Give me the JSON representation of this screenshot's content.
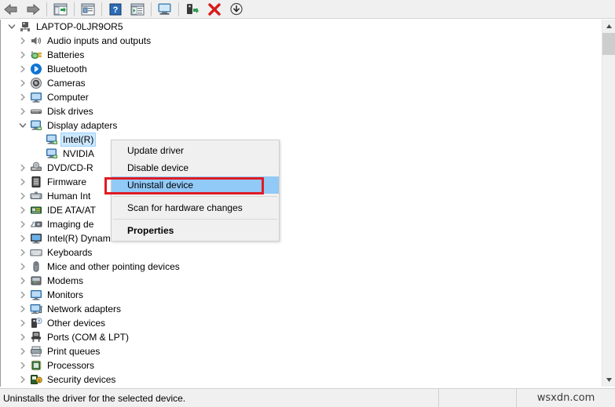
{
  "toolbar": {
    "buttons": [
      {
        "name": "back-icon",
        "label": "Back"
      },
      {
        "name": "forward-icon",
        "label": "Forward"
      },
      {
        "name": "sep",
        "label": ""
      },
      {
        "name": "show-hide-console-tree-icon",
        "label": "Show/Hide Console Tree"
      },
      {
        "name": "sep",
        "label": ""
      },
      {
        "name": "properties-icon",
        "label": "Properties"
      },
      {
        "name": "sep",
        "label": ""
      },
      {
        "name": "help-icon",
        "label": "Help"
      },
      {
        "name": "view-icon",
        "label": "View"
      },
      {
        "name": "sep",
        "label": ""
      },
      {
        "name": "scan-for-hardware-changes-icon",
        "label": "Scan for hardware changes"
      },
      {
        "name": "sep",
        "label": ""
      },
      {
        "name": "update-driver-icon",
        "label": "Update driver"
      },
      {
        "name": "uninstall-device-icon",
        "label": "Uninstall device"
      },
      {
        "name": "disable-device-icon",
        "label": "Disable device"
      }
    ]
  },
  "tree": {
    "rows": [
      {
        "label": "LAPTOP-0LJR9OR5",
        "depth": 0,
        "twisty": "expanded",
        "icon": "computer-node-icon",
        "selected": false
      },
      {
        "label": "Audio inputs and outputs",
        "depth": 1,
        "twisty": "collapsed",
        "icon": "speaker-icon",
        "selected": false
      },
      {
        "label": "Batteries",
        "depth": 1,
        "twisty": "collapsed",
        "icon": "battery-icon",
        "selected": false
      },
      {
        "label": "Bluetooth",
        "depth": 1,
        "twisty": "collapsed",
        "icon": "bluetooth-icon",
        "selected": false
      },
      {
        "label": "Cameras",
        "depth": 1,
        "twisty": "collapsed",
        "icon": "camera-icon",
        "selected": false
      },
      {
        "label": "Computer",
        "depth": 1,
        "twisty": "collapsed",
        "icon": "monitor-icon",
        "selected": false
      },
      {
        "label": "Disk drives",
        "depth": 1,
        "twisty": "collapsed",
        "icon": "disk-drive-icon",
        "selected": false
      },
      {
        "label": "Display adapters",
        "depth": 1,
        "twisty": "expanded",
        "icon": "display-adapter-icon",
        "selected": false
      },
      {
        "label": "Intel(R)",
        "depth": 2,
        "twisty": "none",
        "icon": "display-adapter-icon",
        "selected": true
      },
      {
        "label": "NVIDIA",
        "depth": 2,
        "twisty": "none",
        "icon": "display-adapter-icon",
        "selected": false
      },
      {
        "label": "DVD/CD-R",
        "depth": 1,
        "twisty": "collapsed",
        "icon": "dvd-drive-icon",
        "selected": false
      },
      {
        "label": "Firmware",
        "depth": 1,
        "twisty": "collapsed",
        "icon": "firmware-icon",
        "selected": false
      },
      {
        "label": "Human Int",
        "depth": 1,
        "twisty": "collapsed",
        "icon": "hid-icon",
        "selected": false
      },
      {
        "label": "IDE ATA/AT",
        "depth": 1,
        "twisty": "collapsed",
        "icon": "ide-controller-icon",
        "selected": false
      },
      {
        "label": "Imaging de",
        "depth": 1,
        "twisty": "collapsed",
        "icon": "imaging-device-icon",
        "selected": false
      },
      {
        "label": "Intel(R) Dynamic Platform and Thermal Framework",
        "depth": 1,
        "twisty": "collapsed",
        "icon": "system-device-icon",
        "selected": false
      },
      {
        "label": "Keyboards",
        "depth": 1,
        "twisty": "collapsed",
        "icon": "keyboard-icon",
        "selected": false
      },
      {
        "label": "Mice and other pointing devices",
        "depth": 1,
        "twisty": "collapsed",
        "icon": "mouse-icon",
        "selected": false
      },
      {
        "label": "Modems",
        "depth": 1,
        "twisty": "collapsed",
        "icon": "modem-icon",
        "selected": false
      },
      {
        "label": "Monitors",
        "depth": 1,
        "twisty": "collapsed",
        "icon": "monitor-icon",
        "selected": false
      },
      {
        "label": "Network adapters",
        "depth": 1,
        "twisty": "collapsed",
        "icon": "network-adapter-icon",
        "selected": false
      },
      {
        "label": "Other devices",
        "depth": 1,
        "twisty": "collapsed",
        "icon": "unknown-device-icon",
        "selected": false
      },
      {
        "label": "Ports (COM & LPT)",
        "depth": 1,
        "twisty": "collapsed",
        "icon": "port-icon",
        "selected": false
      },
      {
        "label": "Print queues",
        "depth": 1,
        "twisty": "collapsed",
        "icon": "printer-icon",
        "selected": false
      },
      {
        "label": "Processors",
        "depth": 1,
        "twisty": "collapsed",
        "icon": "processor-icon",
        "selected": false
      },
      {
        "label": "Security devices",
        "depth": 1,
        "twisty": "collapsed",
        "icon": "security-device-icon",
        "selected": false
      }
    ]
  },
  "context_menu": {
    "items": [
      {
        "label": "Update driver",
        "type": "item",
        "highlighted": false,
        "bold": false
      },
      {
        "label": "Disable device",
        "type": "item",
        "highlighted": false,
        "bold": false
      },
      {
        "label": "Uninstall device",
        "type": "item",
        "highlighted": true,
        "bold": false
      },
      {
        "label": "",
        "type": "separator",
        "highlighted": false,
        "bold": false
      },
      {
        "label": "Scan for hardware changes",
        "type": "item",
        "highlighted": false,
        "bold": false
      },
      {
        "label": "",
        "type": "separator",
        "highlighted": false,
        "bold": false
      },
      {
        "label": "Properties",
        "type": "item",
        "highlighted": false,
        "bold": true
      }
    ],
    "highlight_color": "#91c9f7",
    "annotation_color": "#e01b24"
  },
  "statusbar": {
    "text": "Uninstalls the driver for the selected device.",
    "watermark": "wsxdn.com"
  }
}
